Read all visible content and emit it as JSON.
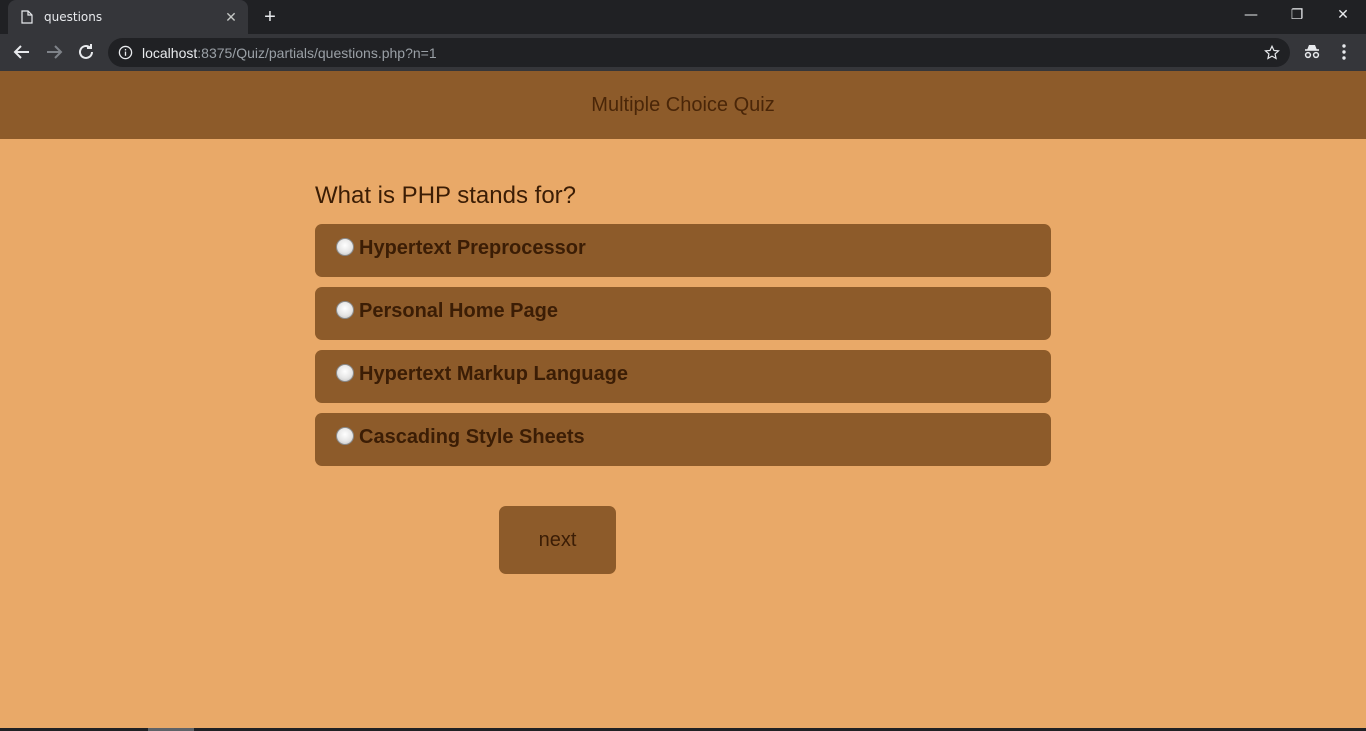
{
  "browser": {
    "tab_title": "questions",
    "new_tab_label": "+",
    "close_tab_label": "✕",
    "url_host": "localhost",
    "url_rest": ":8375/Quiz/partials/questions.php?n=1",
    "window_minimize": "—",
    "window_restore": "❐",
    "window_close": "✕"
  },
  "header": {
    "title": "Multiple Choice Quiz"
  },
  "quiz": {
    "question": "What is PHP stands for?",
    "options": [
      {
        "label": "Hypertext Preprocessor"
      },
      {
        "label": "Personal Home Page"
      },
      {
        "label": "Hypertext Markup Language"
      },
      {
        "label": "Cascading Style Sheets"
      }
    ],
    "next_label": "next"
  },
  "colors": {
    "page_background": "#e9a968",
    "header_background": "#8d5b2a",
    "option_background": "#8d5b2a",
    "text_dark": "#3b1d05"
  }
}
